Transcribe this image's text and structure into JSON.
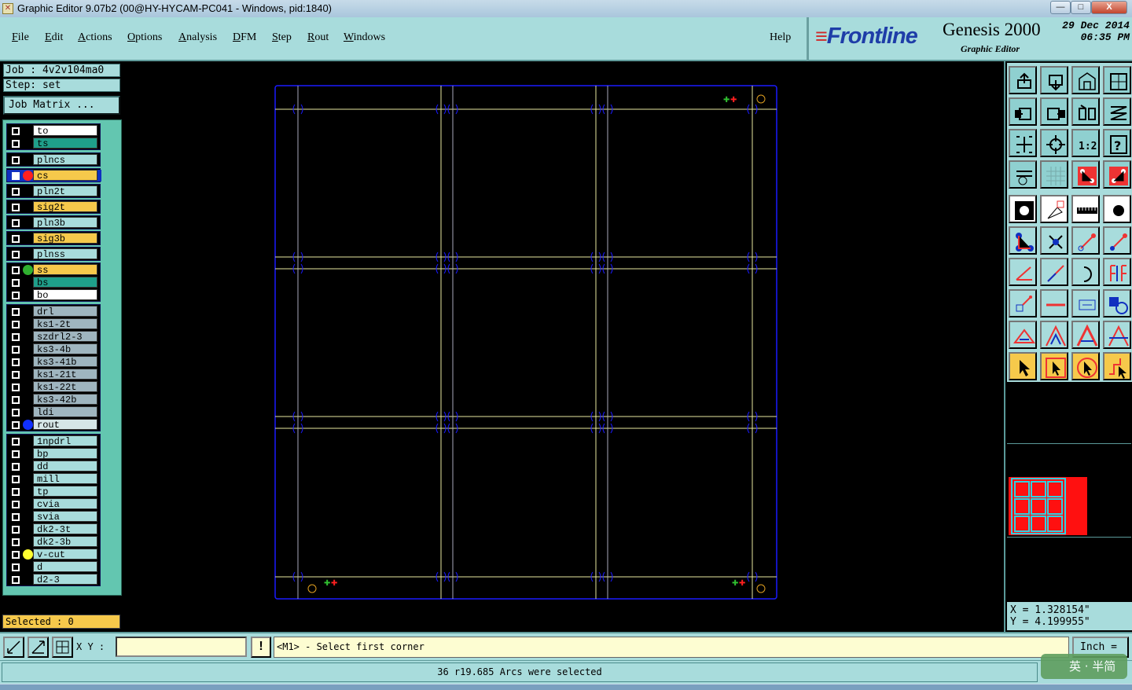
{
  "window": {
    "title": "Graphic Editor 9.07b2 (00@HY-HYCAM-PC041 - Windows, pid:1840)",
    "min_label": "—",
    "max_label": "□",
    "close_label": "X"
  },
  "menu": {
    "items": [
      {
        "label": "File",
        "key": "F",
        "rest": "ile"
      },
      {
        "label": "Edit",
        "key": "E",
        "rest": "dit"
      },
      {
        "label": "Actions",
        "key": "A",
        "rest": "ctions"
      },
      {
        "label": "Options",
        "key": "O",
        "rest": "ptions"
      },
      {
        "label": "Analysis",
        "key": "A",
        "rest": "nalysis"
      },
      {
        "label": "DFM",
        "key": "D",
        "rest": "FM"
      },
      {
        "label": "Step",
        "key": "S",
        "rest": "tep"
      },
      {
        "label": "Rout",
        "key": "R",
        "rest": "out"
      },
      {
        "label": "Windows",
        "key": "W",
        "rest": "indows"
      }
    ],
    "help": "Help"
  },
  "branding": {
    "logo": "Frontline",
    "product": "Genesis 2000",
    "subtitle": "Graphic Editor",
    "date": "29 Dec 2014",
    "time": "06:35 PM"
  },
  "job": {
    "job_label": "Job : 4v2v104ma0",
    "step_label": "Step: set",
    "matrix_button": "Job Matrix ..."
  },
  "layer_groups": [
    {
      "layers": [
        {
          "name": "to",
          "color": "#ffffff"
        },
        {
          "name": "ts",
          "color": "#1f9f8a"
        }
      ]
    },
    {
      "layers": [
        {
          "name": "plncs",
          "color": "#a8dcdc"
        }
      ]
    },
    {
      "layers": [
        {
          "name": "cs",
          "color": "#f6c94b",
          "dot": "#ff2020",
          "active": true
        }
      ]
    },
    {
      "layers": [
        {
          "name": "pln2t",
          "color": "#a8dcdc"
        }
      ]
    },
    {
      "layers": [
        {
          "name": "sig2t",
          "color": "#f6c94b"
        }
      ]
    },
    {
      "layers": [
        {
          "name": "pln3b",
          "color": "#a8dcdc"
        }
      ]
    },
    {
      "layers": [
        {
          "name": "sig3b",
          "color": "#f6c94b"
        }
      ]
    },
    {
      "layers": [
        {
          "name": "plnss",
          "color": "#a8dcdc"
        }
      ]
    },
    {
      "layers": [
        {
          "name": "ss",
          "color": "#f6c94b",
          "dot": "#30b030"
        },
        {
          "name": "bs",
          "color": "#1f9f8a"
        },
        {
          "name": "bo",
          "color": "#ffffff"
        }
      ]
    },
    {
      "layers": [
        {
          "name": "drl",
          "color": "#9fb5bf"
        },
        {
          "name": "ks1-2t",
          "color": "#9fb5bf"
        },
        {
          "name": "szdrl2-3",
          "color": "#9fb5bf"
        },
        {
          "name": "ks3-4b",
          "color": "#9fb5bf"
        },
        {
          "name": "ks3-41b",
          "color": "#9fb5bf"
        },
        {
          "name": "ks1-21t",
          "color": "#9fb5bf"
        },
        {
          "name": "ks1-22t",
          "color": "#9fb5bf"
        },
        {
          "name": "ks3-42b",
          "color": "#9fb5bf"
        },
        {
          "name": "ldi",
          "color": "#9fb5bf"
        },
        {
          "name": "rout",
          "color": "#d6e6e6",
          "dot": "#1030ff"
        }
      ]
    },
    {
      "layers": [
        {
          "name": "1npdrl",
          "color": "#a8dcdc"
        },
        {
          "name": "bp",
          "color": "#a8dcdc"
        },
        {
          "name": "dd",
          "color": "#a8dcdc"
        },
        {
          "name": "mill",
          "color": "#a8dcdc"
        },
        {
          "name": "tp",
          "color": "#a8dcdc"
        },
        {
          "name": "cvia",
          "color": "#a8dcdc"
        },
        {
          "name": "svia",
          "color": "#a8dcdc"
        },
        {
          "name": "dk2-3t",
          "color": "#a8dcdc"
        },
        {
          "name": "dk2-3b",
          "color": "#a8dcdc"
        },
        {
          "name": "v-cut",
          "color": "#a8dcdc",
          "dot": "#ffff30"
        },
        {
          "name": "d",
          "color": "#a8dcdc"
        },
        {
          "name": "d2-3",
          "color": "#a8dcdc"
        }
      ]
    }
  ],
  "selected": "Selected : 0",
  "tools": [
    "home-icon",
    "place-icon",
    "panel-icon",
    "window-icon",
    "zoom-left-icon",
    "zoom-right-icon",
    "mirror-icon",
    "flip-icon",
    "fit-icon",
    "center-icon",
    "scale-1-2-icon",
    "help-icon",
    "measure-icon",
    "grid-icon",
    "snap-icon",
    "snap2-icon",
    "pad-icon",
    "shape-icon",
    "ruler-icon",
    "dot-icon",
    "connect-icon",
    "cross-icon",
    "line-node-icon",
    "line-node2-icon",
    "angle-icon",
    "diag-icon",
    "arc-icon",
    "text-ff-icon",
    "move-icon",
    "minus-icon",
    "bracket-icon",
    "shapes-icon",
    "tri1-icon",
    "tri2-icon",
    "tri3-icon",
    "tri4-icon",
    "pointer-icon",
    "pointer-box-icon",
    "pointer-circle-icon",
    "pointer-path-icon"
  ],
  "coords": {
    "x": "X = 1.328154\"",
    "y": "Y = 4.199955\""
  },
  "command": {
    "xy_label": "X Y :",
    "xy_value": "",
    "info": "!",
    "prompt": "<M1> - Select first corner",
    "unit": "Inch ="
  },
  "status": "36 r19.685 Arcs were selected",
  "ime": "英 · 半简",
  "colors": {
    "panel": "#a8dcdc",
    "board_outline": "#1a1aff",
    "vcut": "#e8e8a0",
    "highlight": "#f6c94b"
  }
}
